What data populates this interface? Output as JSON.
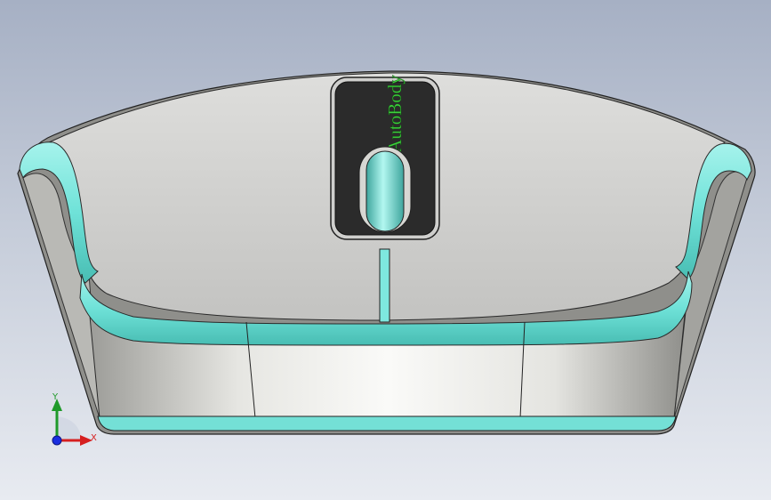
{
  "viewport": {
    "background_top": "#a6b0c4",
    "background_bottom": "#e8ebf1"
  },
  "model": {
    "body_color": "#d4d4d2",
    "accent_color": "#7fe8df",
    "window_color": "#2b2b2b",
    "logo_color": "#3ecf3e",
    "logo_text": "AutoBody"
  },
  "triad": {
    "y_label": "Y",
    "x_label": "X",
    "y_color": "#1f9a2a",
    "x_color": "#d61f1f",
    "z_color": "#1a2ee0",
    "icons": [
      "y-axis-arrow-icon",
      "x-axis-arrow-icon",
      "z-axis-origin-icon"
    ]
  }
}
